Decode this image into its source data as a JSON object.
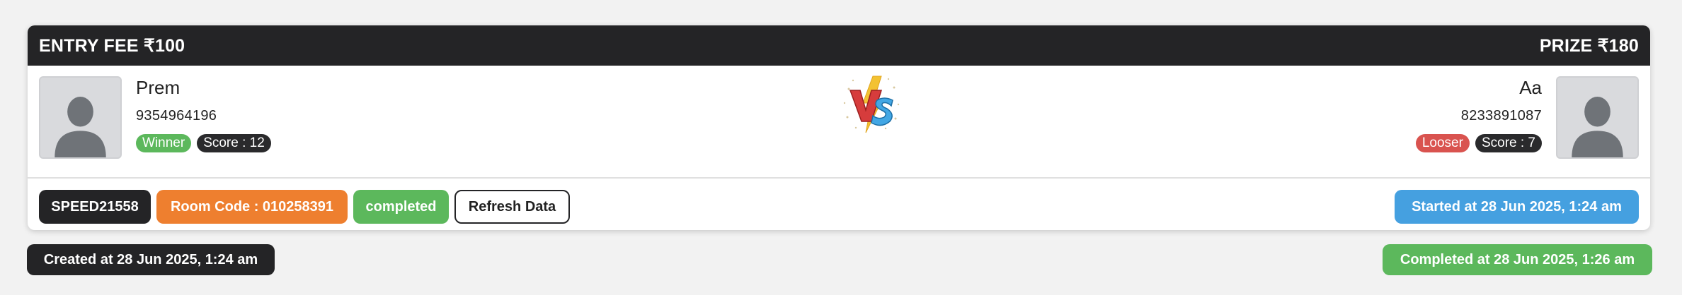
{
  "header": {
    "entry_fee": "ENTRY FEE ₹100",
    "prize": "PRIZE ₹180"
  },
  "player1": {
    "name": "Prem",
    "phone": "9354964196",
    "result": "Winner",
    "score": "Score : 12"
  },
  "player2": {
    "name": "Aa",
    "phone": "8233891087",
    "result": "Looser",
    "score": "Score : 7"
  },
  "actions": {
    "match_code": "SPEED21558",
    "room_code": "Room Code : 010258391",
    "status": "completed",
    "refresh": "Refresh Data",
    "started": "Started at 28 Jun 2025, 1:24 am"
  },
  "footer": {
    "created": "Created at 28 Jun 2025, 1:24 am",
    "completed": "Completed at 28 Jun 2025, 1:26 am"
  },
  "icons": {
    "avatar": "user-avatar-icon",
    "versus": "vs-icon"
  },
  "colors": {
    "header_bg": "#242426",
    "winner": "#5cb85c",
    "looser": "#d9534f",
    "room_code": "#ee7f2f",
    "started": "#45a0e0"
  }
}
